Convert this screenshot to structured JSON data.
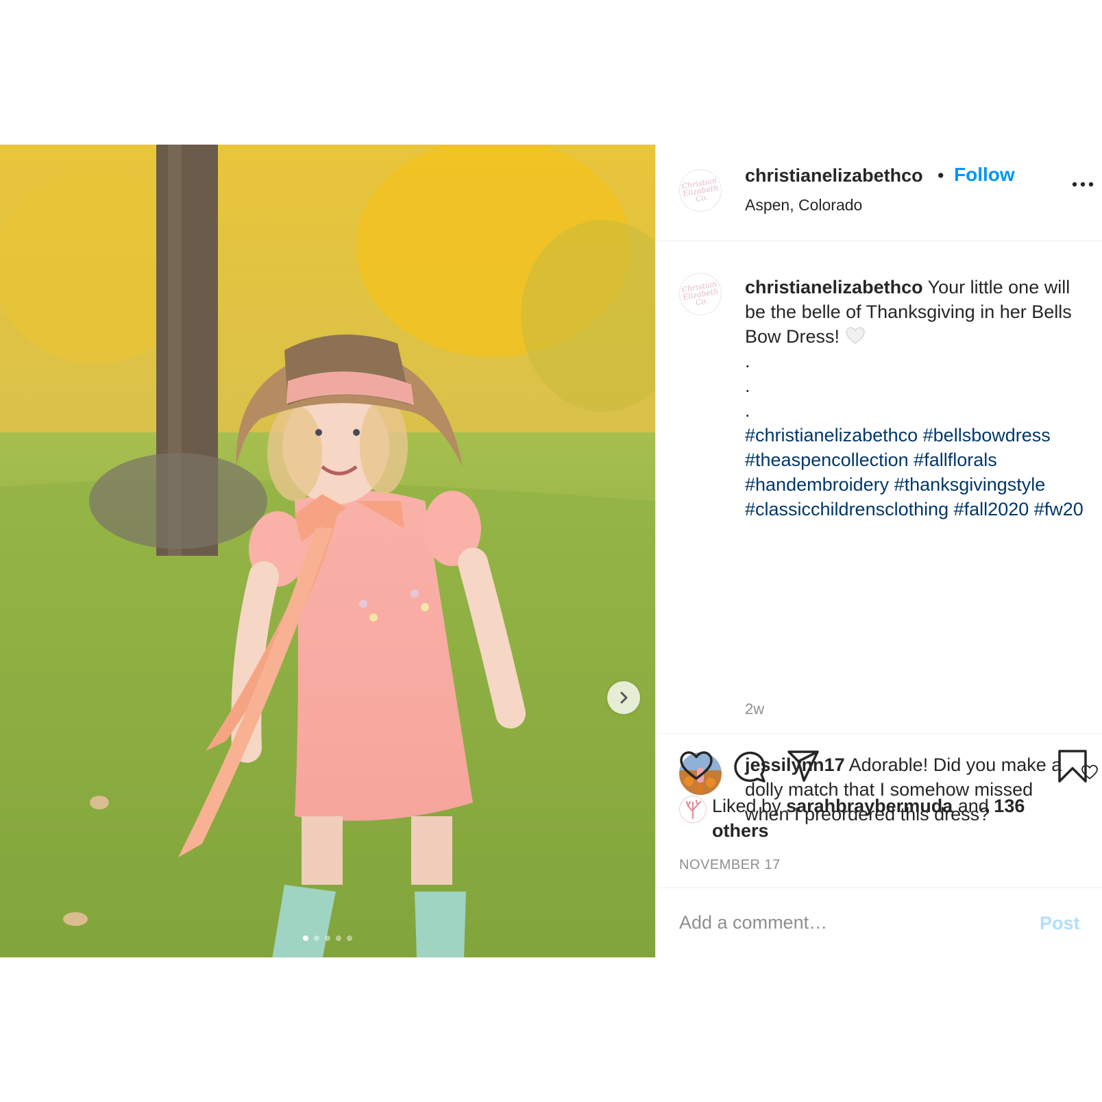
{
  "post": {
    "media": {
      "alt": "",
      "next_icon": "chevron-right-icon",
      "carousel_count": 5,
      "carousel_index": 1
    },
    "header": {
      "username": "christianelizabethco",
      "separator": "•",
      "follow_label": "Follow",
      "location": "Aspen, Colorado",
      "avatar_text": [
        "Christian",
        "Elizabeth",
        "Co."
      ],
      "more_icon": "more-options-icon"
    },
    "caption": {
      "username": "christianelizabethco",
      "text": "Your little one will be the belle of Thanksgiving in her Bells Bow Dress!",
      "emoji": "white-heart-icon",
      "dots": [
        ".",
        ".",
        "."
      ],
      "hashtags": "#christianelizabethco #bellsbowdress #theaspencollection #fallflorals #handembroidery #thanksgivingstyle #classicchildrensclothing #fall2020 #fw20",
      "age": "2w"
    },
    "comments": [
      {
        "username": "jessilynn17",
        "text": "Adorable! Did you make a dolly match that I somehow missed when I preordered this dress?"
      }
    ],
    "actions": {
      "like_icon": "heart-icon",
      "comment_icon": "comment-icon",
      "share_icon": "paper-plane-icon",
      "save_icon": "bookmark-icon"
    },
    "likes": {
      "prefix": "Liked by",
      "first_user": "sarahbraybermuda",
      "conjunction": "and",
      "others": "136 others"
    },
    "date": "NOVEMBER 17",
    "add_comment": {
      "placeholder": "Add a comment…",
      "post_label": "Post"
    }
  },
  "colors": {
    "link_blue": "#0095f6",
    "hashtag_blue": "#00376b",
    "muted": "#8e8e8e",
    "post_disabled": "#b2dffc"
  }
}
